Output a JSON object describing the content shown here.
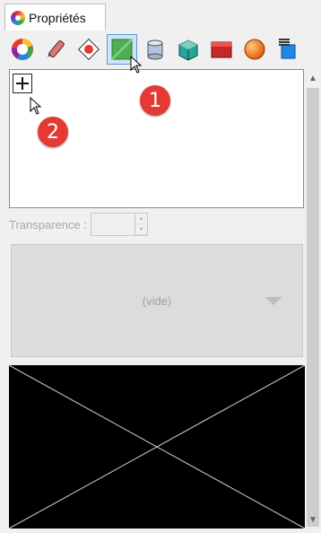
{
  "tab": {
    "label": "Propriétés"
  },
  "toolbar": {
    "buttons": [
      {
        "icon": "color-wheel-icon"
      },
      {
        "icon": "paint-pencil-icon"
      },
      {
        "icon": "decal-icon"
      },
      {
        "icon": "texture-mapping-icon",
        "active": true
      },
      {
        "icon": "cylinder-shape-icon"
      },
      {
        "icon": "box-shape-icon"
      },
      {
        "icon": "red-box-icon"
      },
      {
        "icon": "sphere-shape-icon"
      },
      {
        "icon": "layers-icon"
      }
    ]
  },
  "list": {
    "add_symbol": "+"
  },
  "annotations": {
    "badge1": "1",
    "badge2": "2"
  },
  "transparency": {
    "label": "Transparence :",
    "value": ""
  },
  "dropdown": {
    "value": "(vide)"
  },
  "colors": {
    "badge": "#e53935",
    "active_tab_bg": "#cfe3f7",
    "active_tab_border": "#5b9bd5"
  }
}
